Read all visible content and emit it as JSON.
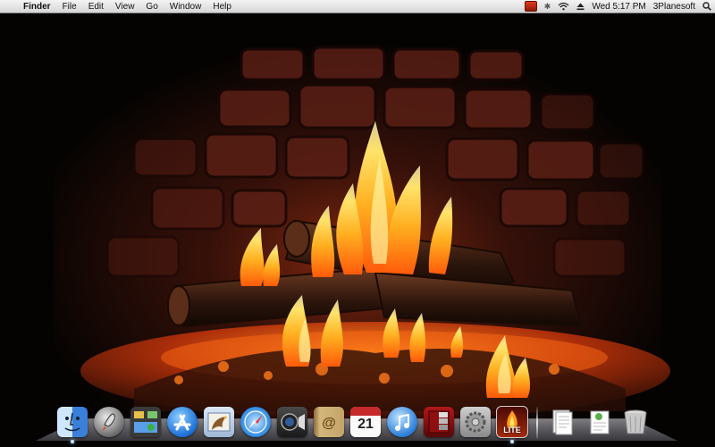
{
  "menubar": {
    "apple_glyph": "",
    "app_name": "Finder",
    "menus": [
      "File",
      "Edit",
      "View",
      "Go",
      "Window",
      "Help"
    ],
    "clock": "Wed 5:17 PM",
    "user": "3Planesoft",
    "status_icons": [
      "fireplace-status-icon",
      "bluetooth-icon",
      "wifi-icon",
      "eject-icon",
      "spotlight-icon"
    ]
  },
  "desktop": {
    "wallpaper": "animated-fireplace",
    "colors": {
      "brick": "#3a1510",
      "fire_core": "#ffd24a",
      "fire_outer": "#e2470f",
      "ember": "#ff6a14"
    }
  },
  "dock": {
    "apps": [
      {
        "id": "finder",
        "icon": "finder-icon",
        "running": true
      },
      {
        "id": "launchpad",
        "icon": "launchpad-icon",
        "running": false
      },
      {
        "id": "mission-control",
        "icon": "mission-control-icon",
        "running": false
      },
      {
        "id": "app-store",
        "icon": "app-store-icon",
        "running": false
      },
      {
        "id": "mail",
        "icon": "mail-icon",
        "running": false
      },
      {
        "id": "safari",
        "icon": "safari-icon",
        "running": false
      },
      {
        "id": "facetime",
        "icon": "facetime-icon",
        "running": false
      },
      {
        "id": "address-book",
        "icon": "address-book-icon",
        "running": false
      },
      {
        "id": "ical",
        "icon": "calendar-icon",
        "running": false,
        "day": "21"
      },
      {
        "id": "itunes",
        "icon": "itunes-icon",
        "running": false
      },
      {
        "id": "photo-booth",
        "icon": "photo-booth-icon",
        "running": false
      },
      {
        "id": "system-preferences",
        "icon": "system-preferences-icon",
        "running": false
      },
      {
        "id": "fireplace-lite",
        "icon": "fireplace-lite-icon",
        "running": true,
        "badge_text": "LITE"
      }
    ],
    "stacks": [
      {
        "id": "documents",
        "icon": "documents-stack-icon"
      },
      {
        "id": "downloads",
        "icon": "downloads-stack-icon"
      },
      {
        "id": "trash",
        "icon": "trash-icon"
      }
    ]
  }
}
